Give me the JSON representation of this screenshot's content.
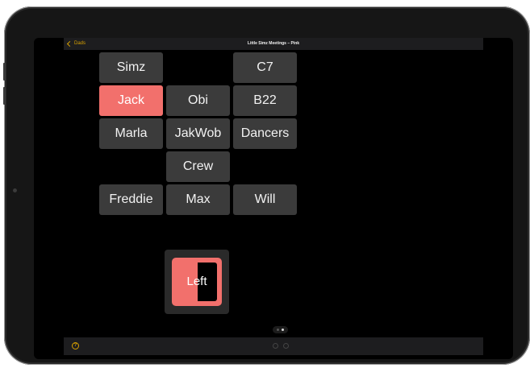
{
  "topbar": {
    "back_label": "Dads",
    "title": "Little Simz Meetings – Pink"
  },
  "grid": {
    "simz": "Simz",
    "c7": "C7",
    "jack": "Jack",
    "obi": "Obi",
    "b22": "B22",
    "marla": "Marla",
    "jakwob": "JakWob",
    "dancers": "Dancers",
    "crew": "Crew",
    "freddie": "Freddie",
    "max": "Max",
    "will": "Will",
    "selected": "Jack"
  },
  "toggle": {
    "label": "Left",
    "state": "Left"
  },
  "pager": {
    "page_count": 2,
    "current_page": 2
  },
  "colors": {
    "accent": "#f2706c",
    "tint": "#d8a100",
    "button_bg": "#3b3b3b",
    "bar_bg": "#1d1d1f"
  },
  "icons": {
    "back": "chevron-left-icon",
    "help": "question-circle-icon"
  }
}
